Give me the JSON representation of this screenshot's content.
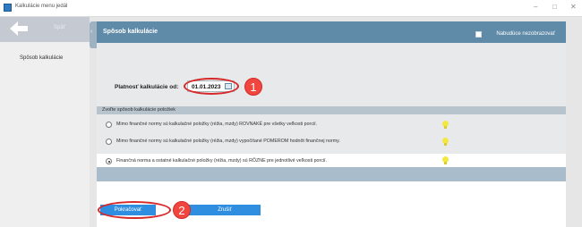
{
  "window": {
    "title": "Kalkulácie menu jedál",
    "minimize_glyph": "–",
    "maximize_glyph": "□",
    "close_glyph": "✕"
  },
  "sidebar": {
    "back_label": "Späť",
    "items": [
      {
        "label": "Spôsob kalkulácie"
      }
    ]
  },
  "main": {
    "title": "Spôsob kalkulácie",
    "collapse_glyph": "‹",
    "dont_show_label": "Nabudúce nezobrazovať",
    "date_label": "Platnosť kalkulácie od:",
    "date_value": "01.01.2023",
    "group_header": "Zvoľte spôsob kalkulácie položiek",
    "options": [
      {
        "label": "Mimo finančné normy sú kalkulačné položky (réžia, mzdy) ROVNAKÉ pre všetky veľkosti porcií.",
        "selected": false
      },
      {
        "label": "Mimo finančné normy sú kalkulačné položky (réžia, mzdy) vypočítané POMEROM hodnôt finančnej normy.",
        "selected": false
      },
      {
        "label": "Finančná norma a ostatné kalkulačné položky (réžia, mzdy) sú RÔZNE pre jednotlivé veľkosti porcií.",
        "selected": true
      }
    ],
    "continue_label": "Pokračovať",
    "cancel_label": "Zrušiť"
  },
  "annotations": {
    "marker_1": "1",
    "marker_2": "2",
    "color": "#d62a2a"
  },
  "colors": {
    "header_bg": "#5f8aa8",
    "button_bg": "#2f8ee0",
    "hint_bulb": "#f3e840"
  }
}
